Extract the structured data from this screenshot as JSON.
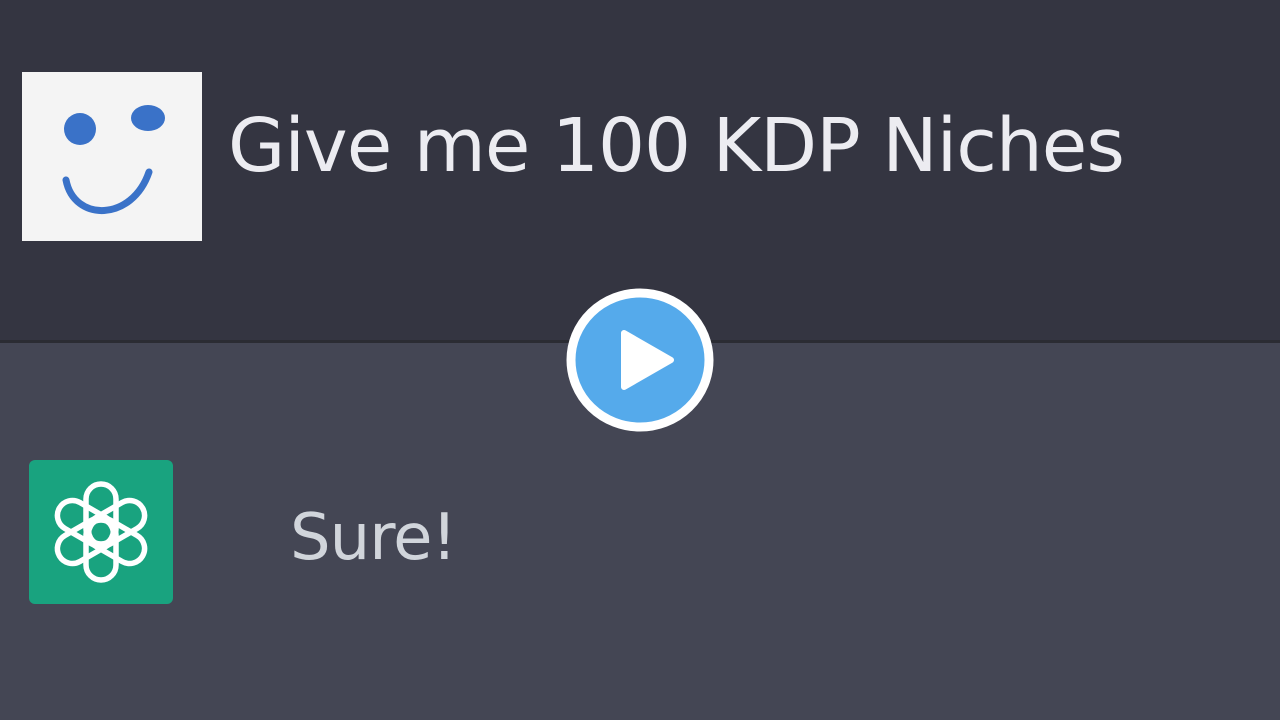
{
  "conversation": {
    "user_message": "Give me 100 KDP Niches",
    "assistant_message": "Sure!"
  },
  "icons": {
    "user_avatar": "smiley-face-icon",
    "assistant_avatar": "chatgpt-logo-icon",
    "play": "play-icon"
  },
  "colors": {
    "user_turn_background": "#343541",
    "assistant_turn_background": "#444654",
    "assistant_avatar_background": "#19a37f",
    "play_button": "#55aaeb",
    "smiley_ink": "#3a72c8"
  }
}
